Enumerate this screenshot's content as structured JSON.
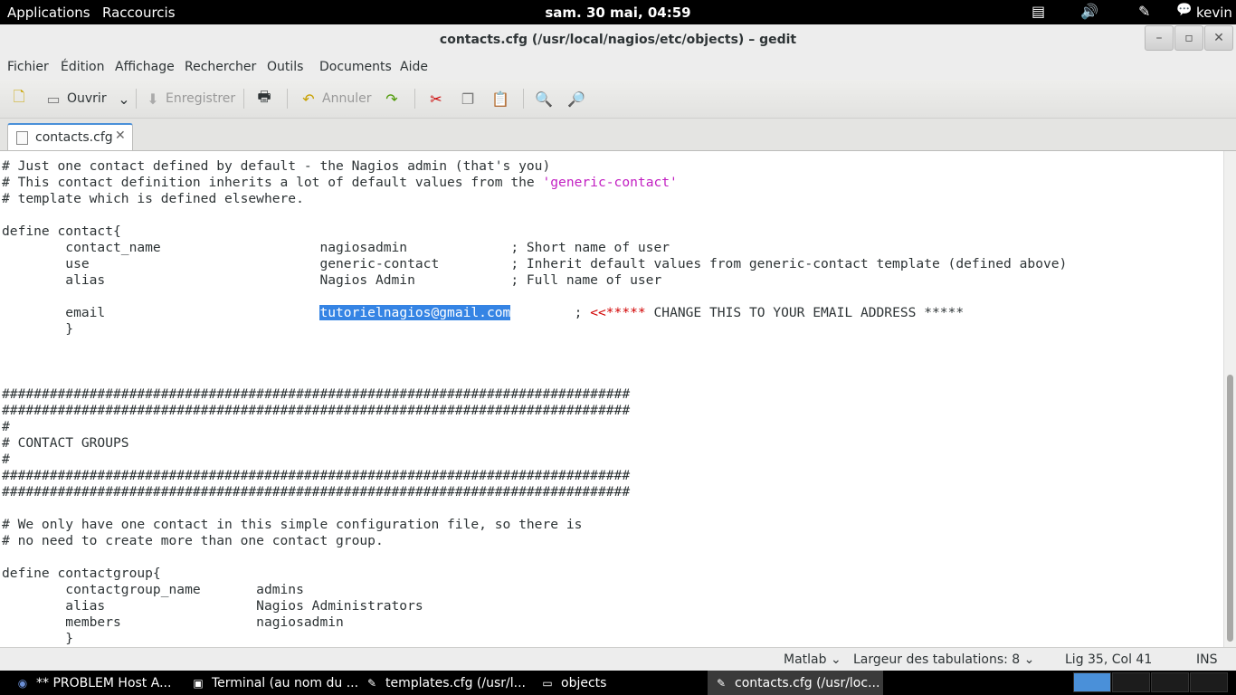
{
  "top_panel": {
    "applications": "Applications",
    "shortcuts": "Raccourcis",
    "clock": "sam. 30 mai, 04:59",
    "user": "kevin"
  },
  "window": {
    "title": "contacts.cfg (/usr/local/nagios/etc/objects) – gedit"
  },
  "menu": [
    "Fichier",
    "Édition",
    "Affichage",
    "Rechercher",
    "Outils",
    "Documents",
    "Aide"
  ],
  "toolbar": {
    "open": "Ouvrir",
    "save": "Enregistrer",
    "undo": "Annuler"
  },
  "tab": {
    "label": "contacts.cfg",
    "close": "✕"
  },
  "editor": {
    "l1": "# Just one contact defined by default - the Nagios admin (that's you)",
    "l2a": "# This contact definition inherits a lot of default values from the ",
    "l2b": "'generic-contact'",
    "l3": "# template which is defined elsewhere.",
    "l5": "define contact{",
    "l6": "        contact_name                    nagiosadmin             ; Short name of user",
    "l7": "        use                             generic-contact         ; Inherit default values from generic-contact template (defined above)",
    "l8": "        alias                           Nagios Admin            ; Full name of user",
    "l10a": "        email                           ",
    "l10b": "tutorielnagios@gmail.com",
    "l10c": "        ; ",
    "l10d": "<<*****",
    "l10e": " CHANGE THIS TO YOUR EMAIL ADDRESS *****",
    "l11": "        }",
    "l15": "###############################################################################",
    "l16": "###############################################################################",
    "l17": "#",
    "l18": "# CONTACT GROUPS",
    "l19": "#",
    "l20": "###############################################################################",
    "l21": "###############################################################################",
    "l23": "# We only have one contact in this simple configuration file, so there is",
    "l24": "# no need to create more than one contact group.",
    "l26": "define contactgroup{",
    "l27": "        contactgroup_name       admins",
    "l28": "        alias                   Nagios Administrators",
    "l29": "        members                 nagiosadmin",
    "l30": "        }"
  },
  "status": {
    "language": "Matlab",
    "tab_width": "Largeur des tabulations:  8",
    "position": "Lig 35, Col 41",
    "mode": "INS"
  },
  "taskbar": [
    "** PROBLEM Host A...",
    "Terminal (au nom du ...",
    "templates.cfg (/usr/l...",
    "objects",
    "contacts.cfg (/usr/loc..."
  ]
}
